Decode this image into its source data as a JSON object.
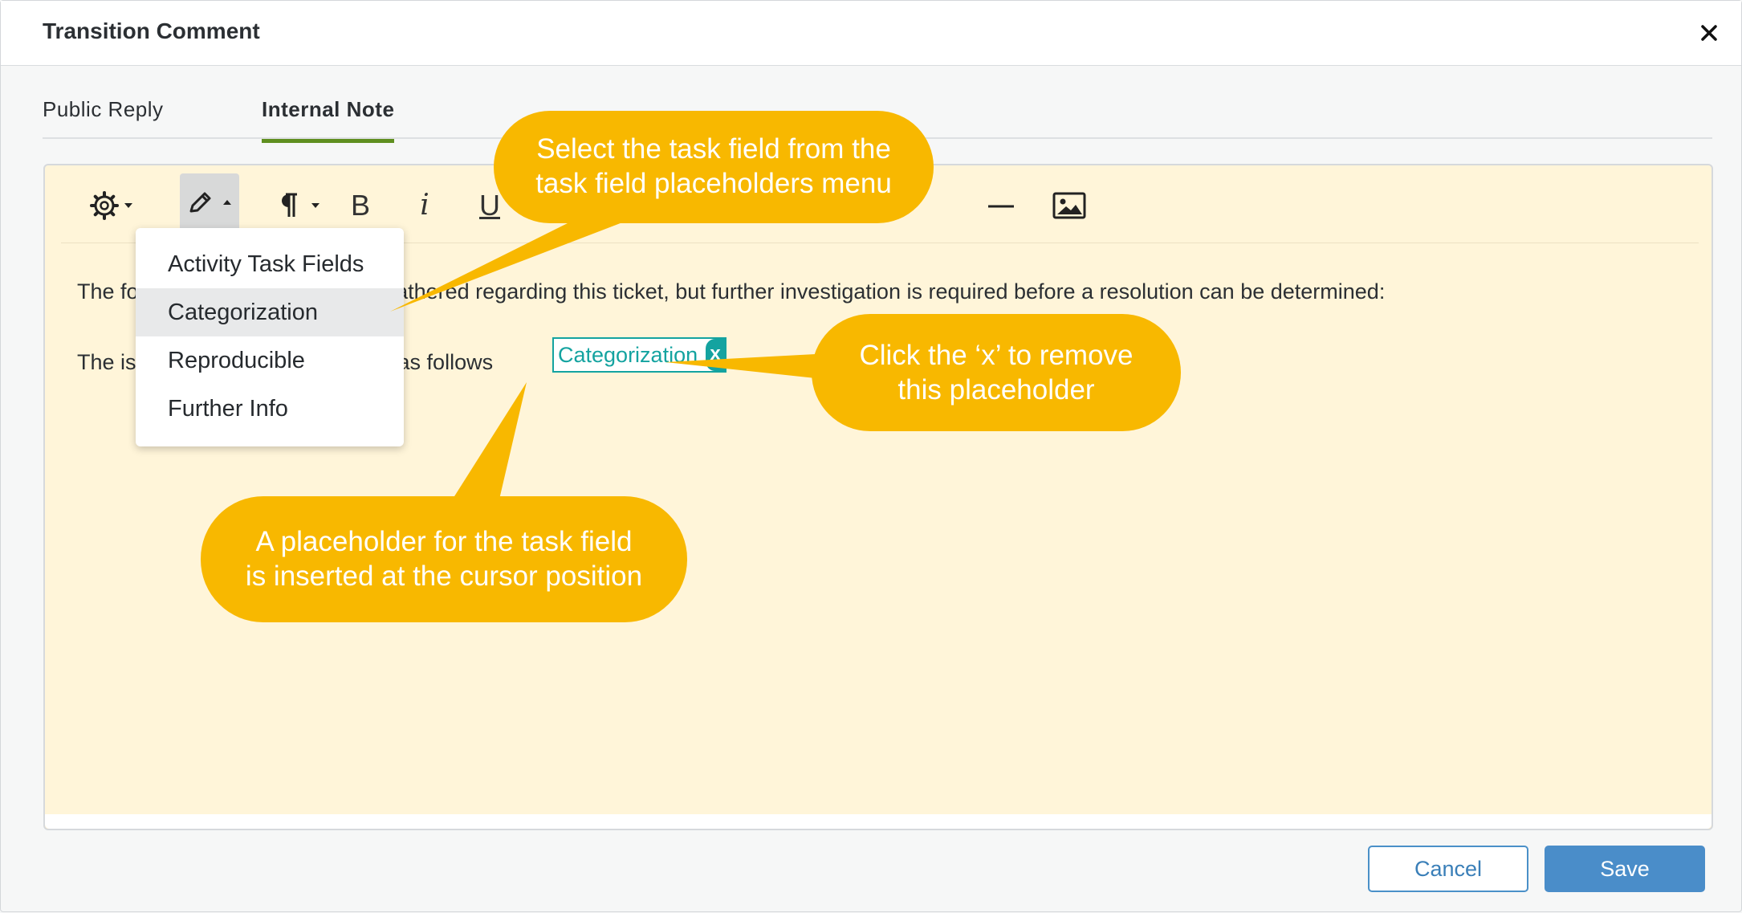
{
  "dialog": {
    "title": "Transition Comment"
  },
  "tabs": [
    {
      "label": "Public Reply",
      "active": false
    },
    {
      "label": "Internal Note",
      "active": true
    }
  ],
  "toolbar": {
    "buttons": [
      {
        "icon": "gear-icon"
      },
      {
        "icon": "pencil-icon",
        "active": true
      },
      {
        "icon": "paragraph-icon"
      },
      {
        "icon": "bold-icon",
        "label": "B"
      },
      {
        "icon": "italic-icon",
        "label": "i"
      },
      {
        "icon": "underline-icon",
        "label": "U"
      },
      {
        "icon": "horizontal-rule-icon"
      },
      {
        "icon": "image-icon"
      }
    ]
  },
  "editor": {
    "line1_start": "The fo",
    "line1_end": "en gathered regarding this ticket, but further investigation is required before a resolution can be determined:",
    "line2_start": "The is",
    "line2_end": "as follows",
    "placeholder_chip": {
      "label": "Categorization",
      "remove": "x"
    }
  },
  "menu": {
    "items": [
      {
        "label": "Activity Task Fields"
      },
      {
        "label": "Categorization",
        "highlighted": true
      },
      {
        "label": "Reproducible"
      },
      {
        "label": "Further Info"
      }
    ]
  },
  "callouts": [
    {
      "text_line1": "Select the task field from the",
      "text_line2": "task field placeholders menu"
    },
    {
      "text_line1": "Click the ‘x’ to remove",
      "text_line2": "this placeholder"
    },
    {
      "text_line1": "A placeholder for the task field",
      "text_line2": "is inserted at the cursor position"
    }
  ],
  "colors": {
    "editor_bg": "#fff5d9",
    "callout": "#f8b800",
    "chip": "#14a3a0",
    "tab_underline": "#5f8f1f",
    "primary": "#4a8dc9"
  },
  "footer": {
    "cancel_label": "Cancel",
    "save_label": "Save"
  }
}
